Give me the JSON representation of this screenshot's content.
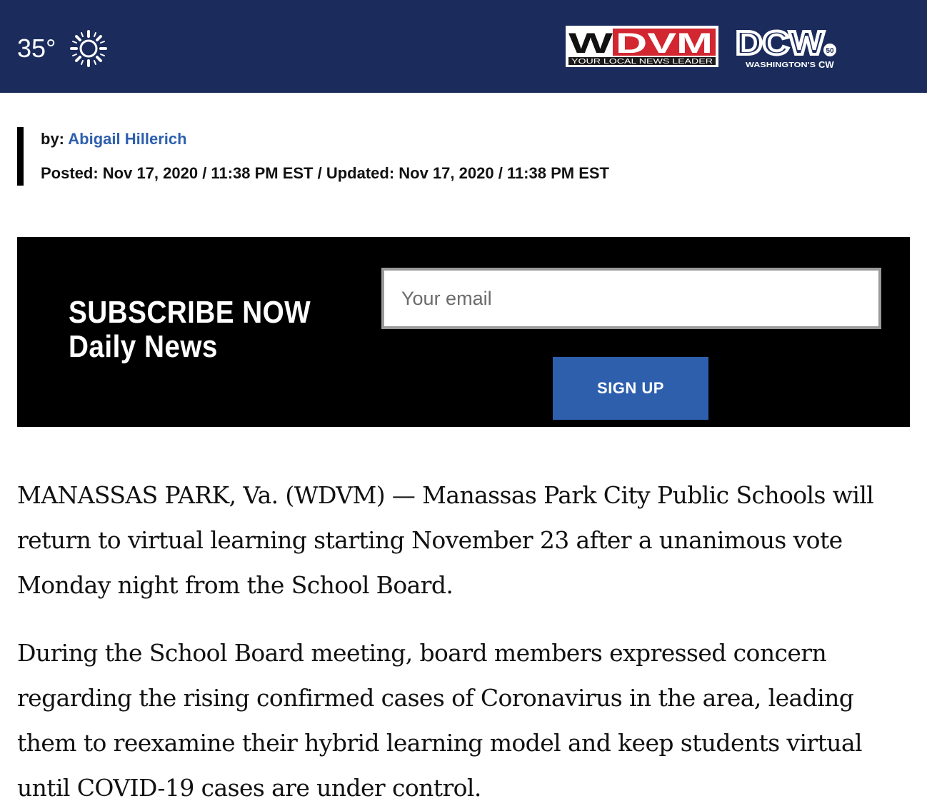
{
  "header": {
    "temperature": "35°",
    "weather_icon": "sun-icon",
    "background_color": "#1b2c5c",
    "logos": {
      "wdvm": {
        "text": "WDVM",
        "tagline": "YOUR LOCAL NEWS LEADER"
      },
      "dcw": {
        "text": "DCW",
        "number": "50",
        "tagline": "WASHINGTON'S",
        "network": "CW"
      }
    }
  },
  "byline": {
    "by_label": "by:",
    "author": "Abigail Hillerich",
    "posted": "Posted: Nov 17, 2020 / 11:38 PM EST / Updated: Nov 17, 2020 / 11:38 PM EST"
  },
  "subscribe": {
    "title_line1": "SUBSCRIBE NOW",
    "title_line2": "Daily News",
    "email_placeholder": "Your email",
    "signup_label": "SIGN UP",
    "accent_color": "#2d5fad"
  },
  "article": {
    "paragraphs": [
      "MANASSAS PARK, Va. (WDVM) — Manassas Park City Public Schools will return to virtual learning starting November 23 after a unanimous vote Monday night from the School Board.",
      "During the School Board meeting, board members expressed concern regarding the rising confirmed cases of Coronavirus in the area, leading them to reexamine their hybrid learning model and keep students virtual until COVID-19 cases are under control."
    ]
  }
}
